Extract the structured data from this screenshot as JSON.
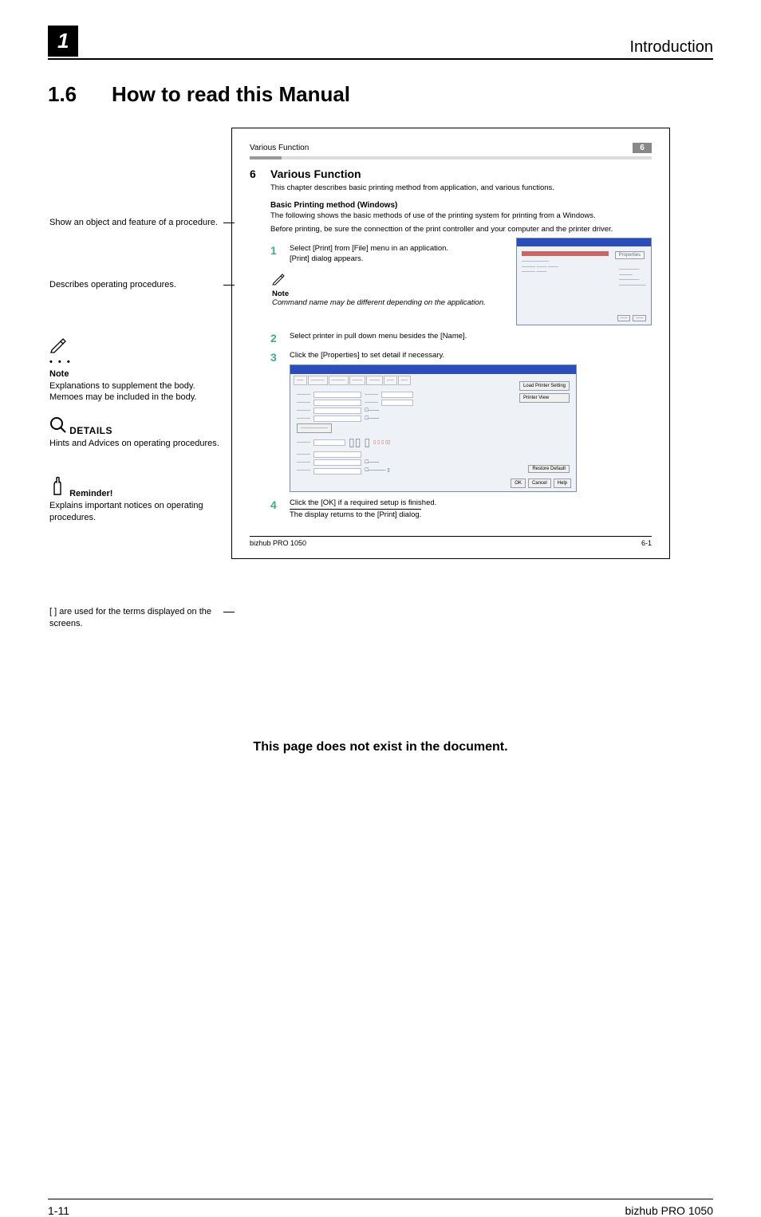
{
  "header": {
    "chapter_badge": "1",
    "section_label": "Introduction"
  },
  "section": {
    "number": "1.6",
    "title": "How to read this Manual"
  },
  "callouts": {
    "show_object": "Show an object and feature of a procedure.",
    "describes": "Describes operating procedures.",
    "note_label": "Note",
    "note_body": "Explanations to supplement the body.\nMemoes may be included in the body.",
    "details_label": "DETAILS",
    "details_body": "Hints and Advices on operating procedures.",
    "reminder_label": "Reminder!",
    "reminder_body": "Explains important notices on operating procedures.",
    "brackets": "[  ] are used for the terms displayed on the screens."
  },
  "sample": {
    "running_head": "Various Function",
    "running_num": "6",
    "ch_num": "6",
    "h1": "Various Function",
    "intro": "This chapter describes basic printing method from application, and various functions.",
    "sub1": "Basic Printing method (Windows)",
    "sub1_p1": "The following shows the basic methods of use of the printing system for printing from a Windows.",
    "sub1_p2": "Before printing, be sure the connecttion of the print controller and your computer and the printer driver.",
    "step1_num": "1",
    "step1_a": "Select [Print] from [File] menu in an application.",
    "step1_b": "[Print] dialog appears.",
    "note_label": "Note",
    "note_body": "Command name may be different depending on the application.",
    "step2_num": "2",
    "step2": "Select printer in pull down menu besides the [Name].",
    "step3_num": "3",
    "step3": "Click the [Properties] to set detail if necessary.",
    "step4_num": "4",
    "step4_a": "Click the [OK] if a required setup is finished.",
    "step4_b": "The display returns to the [Print] dialog.",
    "shot1": {
      "btn": "Properties"
    },
    "shot2": {
      "upper_btn1": "Load Printer Setting",
      "upper_btn2": "Printer View",
      "ok": "OK",
      "cancel": "Cancel",
      "help": "Help",
      "restore": "Restore Default"
    },
    "foot_left": "bizhub PRO 1050",
    "foot_right": "6-1"
  },
  "nonexist_note": "This page does not exist in the document.",
  "footer": {
    "left": "1-11",
    "right": "bizhub PRO 1050"
  }
}
